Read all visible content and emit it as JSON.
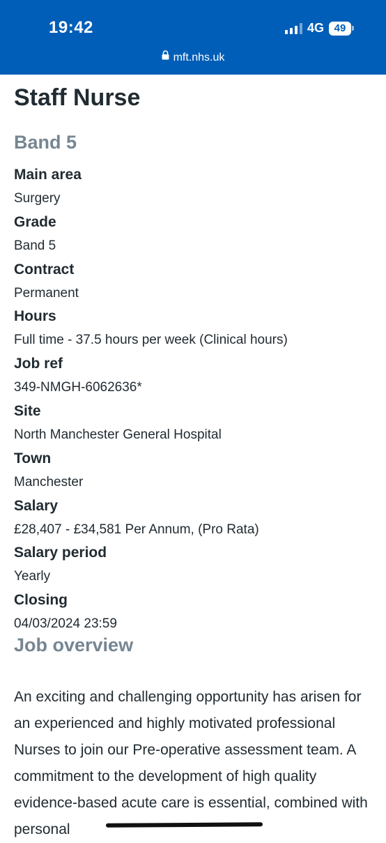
{
  "status_bar": {
    "time": "19:42",
    "network": "4G",
    "battery": "49"
  },
  "browser": {
    "url": "mft.nhs.uk"
  },
  "job": {
    "title": "Staff Nurse",
    "band": "Band 5",
    "details": [
      {
        "label": "Main area",
        "value": "Surgery"
      },
      {
        "label": "Grade",
        "value": "Band 5"
      },
      {
        "label": "Contract",
        "value": "Permanent"
      },
      {
        "label": "Hours",
        "value": "Full time - 37.5 hours per week (Clinical hours)"
      },
      {
        "label": "Job ref",
        "value": "349-NMGH-6062636*"
      },
      {
        "label": "Site",
        "value": "North Manchester General Hospital"
      },
      {
        "label": "Town",
        "value": "Manchester"
      },
      {
        "label": "Salary",
        "value": "£28,407 - £34,581 Per Annum, (Pro Rata)"
      },
      {
        "label": "Salary period",
        "value": "Yearly"
      },
      {
        "label": "Closing",
        "value": "04/03/2024 23:59"
      }
    ],
    "overview_heading": "Job overview",
    "overview_text": "An exciting and challenging opportunity has arisen for an experienced and highly motivated professional Nurses to join our Pre-operative assessment team.  A commitment to the development of high quality evidence-based acute care is essential, combined with personal"
  }
}
